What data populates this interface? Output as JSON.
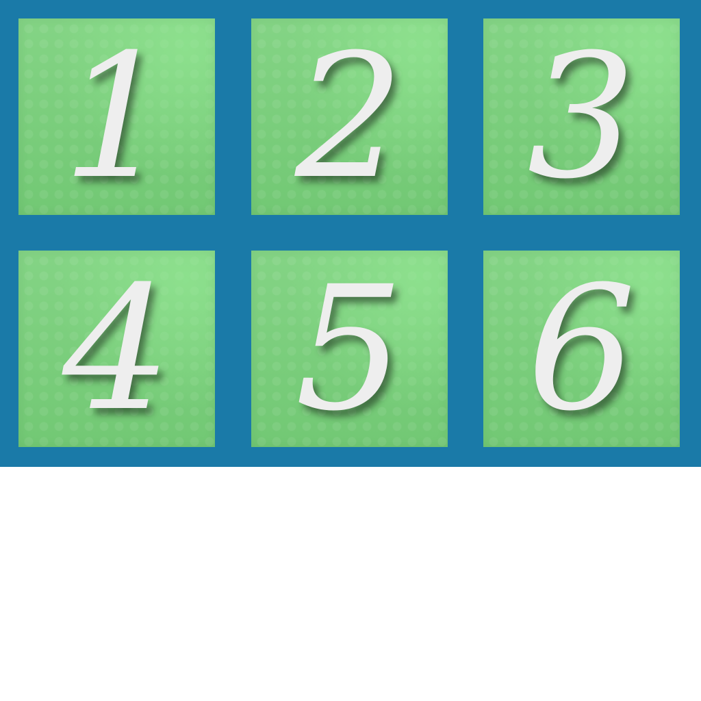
{
  "board": {
    "tiles": [
      {
        "label": "1"
      },
      {
        "label": "2"
      },
      {
        "label": "3"
      },
      {
        "label": "4"
      },
      {
        "label": "5"
      },
      {
        "label": "6"
      }
    ]
  },
  "colors": {
    "frame": "#1a7aa8",
    "tile": "#7fd180",
    "numeral": "#eeeeee",
    "page": "#ffffff"
  }
}
